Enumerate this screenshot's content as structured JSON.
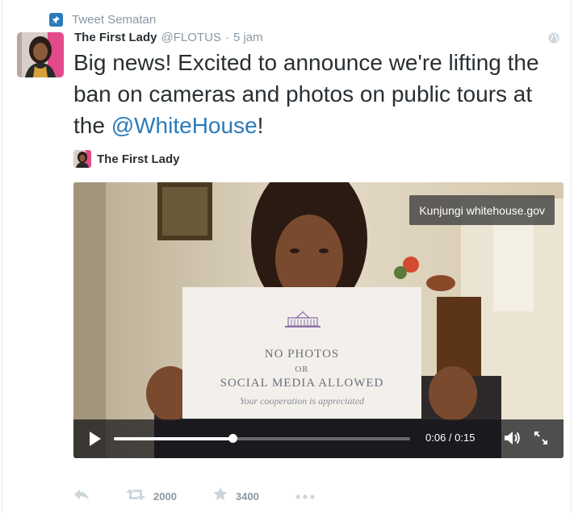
{
  "pinned": {
    "label": "Tweet Sematan"
  },
  "tweet": {
    "author_name": "The First Lady",
    "handle": "@FLOTUS",
    "separator": "·",
    "time": "5 jam",
    "text_part1": "Big news! Excited to announce we're lifting the ban on cameras and photos on public tours at the ",
    "mention": "@WhiteHouse",
    "text_part2": "!"
  },
  "card": {
    "author_name": "The First Lady",
    "visit_label": "Kunjungi whitehouse.gov",
    "sign": {
      "line1": "NO PHOTOS",
      "line2": "OR",
      "line3": "SOCIAL MEDIA ALLOWED",
      "line4": "Your cooperation is appreciated"
    }
  },
  "player": {
    "time_display": "0:06 / 0:15",
    "progress": 0.4
  },
  "actions": {
    "retweet_count": "2000",
    "favorite_count": "3400"
  },
  "colors": {
    "link": "#2b7bb9",
    "meta": "#8899a6",
    "text": "#292f33"
  },
  "icons": [
    "pin-icon",
    "globe-icon",
    "play-icon",
    "volume-icon",
    "fullscreen-icon",
    "reply-icon",
    "retweet-icon",
    "favorite-icon",
    "more-icon"
  ]
}
